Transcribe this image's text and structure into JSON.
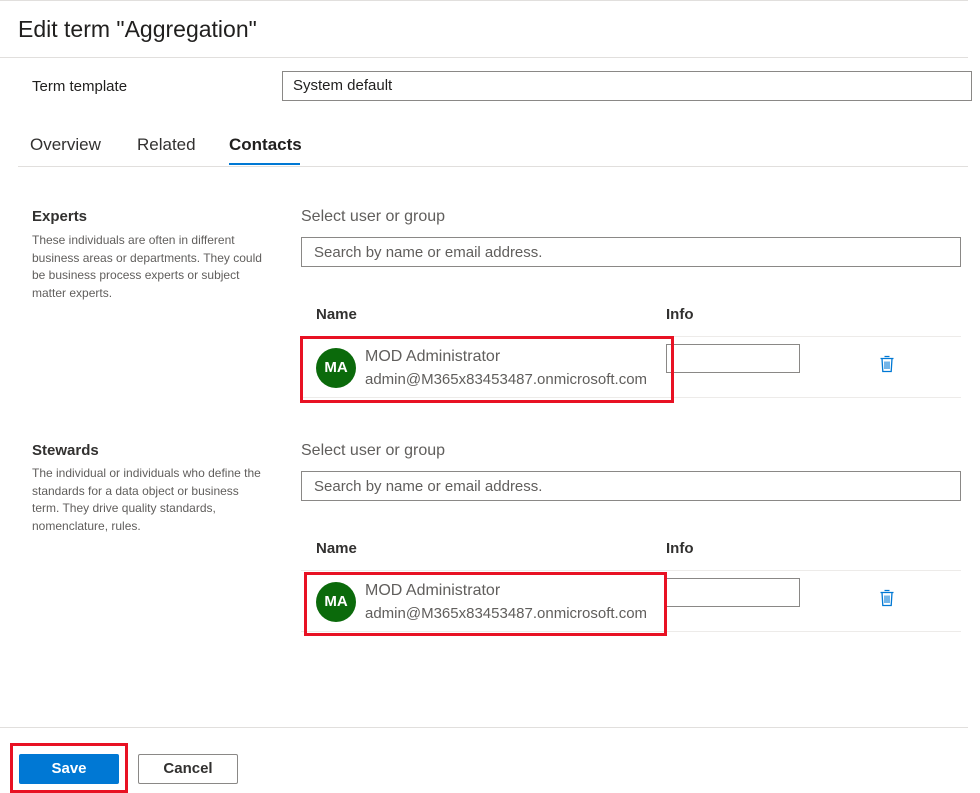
{
  "dialog": {
    "title": "Edit term \"Aggregation\""
  },
  "term_template": {
    "label": "Term template",
    "value": "System default"
  },
  "tabs": [
    {
      "label": "Overview",
      "active": false
    },
    {
      "label": "Related",
      "active": false
    },
    {
      "label": "Contacts",
      "active": true
    }
  ],
  "experts": {
    "title": "Experts",
    "description": "These individuals are often in different business areas or departments. They could be business process experts or subject matter experts.",
    "select_label": "Select user or group",
    "search_placeholder": "Search by name or email address.",
    "col_name": "Name",
    "col_info": "Info",
    "contacts": [
      {
        "initials": "MA",
        "name": "MOD Administrator",
        "email": "admin@M365x83453487.onmicrosoft.com",
        "info": ""
      }
    ]
  },
  "stewards": {
    "title": "Stewards",
    "description": "The individual or individuals who define the standards for a data object or business term. They drive quality standards, nomenclature, rules.",
    "select_label": "Select user or group",
    "search_placeholder": "Search by name or email address.",
    "col_name": "Name",
    "col_info": "Info",
    "contacts": [
      {
        "initials": "MA",
        "name": "MOD Administrator",
        "email": "admin@M365x83453487.onmicrosoft.com",
        "info": ""
      }
    ]
  },
  "footer": {
    "save_label": "Save",
    "cancel_label": "Cancel"
  },
  "colors": {
    "accent": "#0078d4",
    "avatar": "#0b6a0b",
    "highlight": "#e81123"
  }
}
